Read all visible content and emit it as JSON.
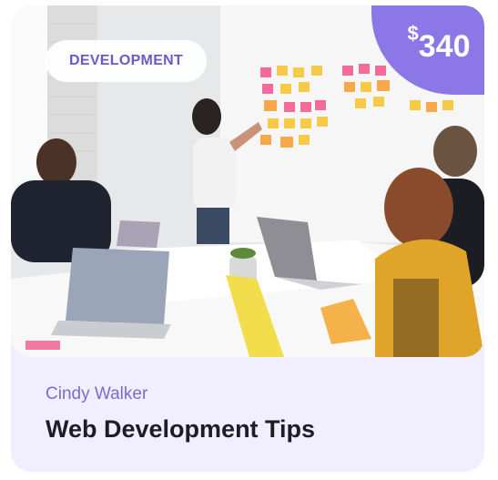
{
  "card": {
    "category": "DEVELOPMENT",
    "price": {
      "currency": "$",
      "amount": "340"
    },
    "author": "Cindy Walker",
    "title": "Web Development Tips",
    "colors": {
      "accent": "#8b78e6",
      "card_bg": "#f1efff",
      "title": "#1d1d24",
      "author": "#7b6bd0"
    },
    "image_alt_icon": "photo-icon"
  }
}
